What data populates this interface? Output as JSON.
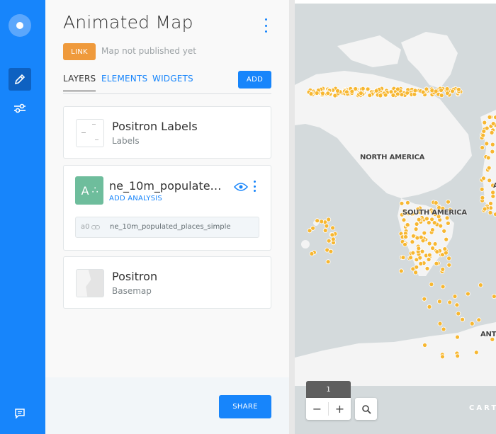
{
  "app": {
    "title": "Animated Map",
    "link_label": "LINK",
    "status": "Map not published yet"
  },
  "tabs": {
    "layers": "LAYERS",
    "elements": "ELEMENTS",
    "widgets": "WIDGETS",
    "add": "ADD"
  },
  "layers": [
    {
      "name": "Positron Labels",
      "type": "Labels"
    },
    {
      "letter": "A",
      "name": "ne_10m_populated_places_simple",
      "action": "ADD ANALYSIS",
      "node": "a0",
      "source": "ne_10m_populated_places_simple",
      "color": "#6ebd9c"
    },
    {
      "name": "Positron",
      "type": "Basemap"
    }
  ],
  "footer": {
    "share": "SHARE"
  },
  "map": {
    "labels": {
      "north_america": "NORTH AMERICA",
      "south_america": "SOUTH AMERICA",
      "antarctica": "ANT",
      "partial": "A"
    },
    "zoom_level": "1",
    "zoom_out": "−",
    "zoom_in": "+",
    "attribution": "CART",
    "point_color": "#f7b731"
  },
  "colors": {
    "accent": "#1785fb",
    "link_tag": "#ef9a3c"
  }
}
